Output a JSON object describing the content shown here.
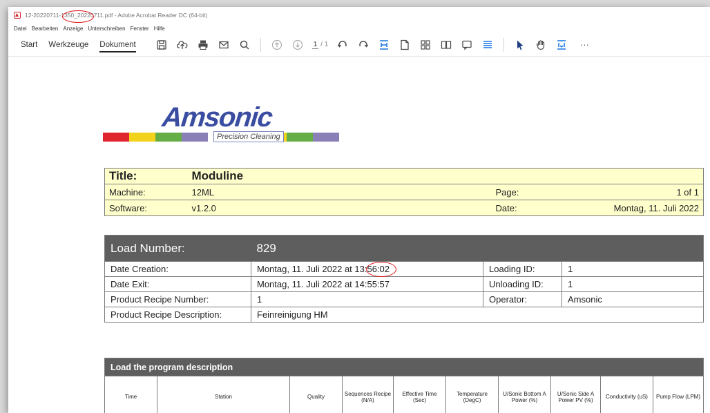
{
  "window": {
    "title": "12-20220711-1350_20220711.pdf - Adobe Acrobat Reader DC (64-bit)"
  },
  "menu": {
    "items": [
      "Datei",
      "Bearbeiten",
      "Anzeige",
      "Unterschreiben",
      "Fenster",
      "Hilfe"
    ]
  },
  "toolbar": {
    "tabs": [
      "Start",
      "Werkzeuge",
      "Dokument"
    ],
    "active_tab": "Dokument",
    "page_current": "1",
    "page_total": "/ 1",
    "more_label": "···",
    "icons": [
      "save-icon",
      "upload-icon",
      "print-icon",
      "email-icon",
      "search-icon",
      "page-up-icon",
      "page-down-icon",
      "rotate-left-icon",
      "rotate-right-icon",
      "fit-page-icon",
      "single-page-icon",
      "thumbnails-icon",
      "two-page-icon",
      "comment-icon",
      "highlight-icon",
      "select-icon",
      "hand-icon",
      "fit-width-icon"
    ]
  },
  "logo": {
    "word": "Amsonic",
    "tagline": "Precision Cleaning",
    "stripe_colors": [
      "#e0252f",
      "#f3d21c",
      "#65ad45",
      "#8b7fb7",
      "#ffffff",
      "#e0252f",
      "#f3d21c",
      "#65ad45",
      "#8b7fb7"
    ]
  },
  "info": {
    "title_label": "Title:",
    "title_value": "Moduline",
    "machine_label": "Machine:",
    "machine_value": "12ML",
    "page_label": "Page:",
    "page_value": "1 of 1",
    "software_label": "Software:",
    "software_value": "v1.2.0",
    "date_label": "Date:",
    "date_value": "Montag, 11. Juli 2022"
  },
  "load": {
    "number_label": "Load Number:",
    "number_value": "829",
    "creation_label": "Date Creation:",
    "creation_value": "Montag, 11. Juli 2022 at 13:56:02",
    "loading_id_label": "Loading ID:",
    "loading_id_value": "1",
    "exit_label": "Date Exit:",
    "exit_value": "Montag, 11. Juli 2022 at 14:55:57",
    "unloading_id_label": "Unloading ID:",
    "unloading_id_value": "1",
    "recipe_number_label": "Product Recipe Number:",
    "recipe_number_value": "1",
    "operator_label": "Operator:",
    "operator_value": "Amsonic",
    "recipe_desc_label": "Product Recipe Description:",
    "recipe_desc_value": "Feinreinigung HM"
  },
  "program": {
    "heading": "Load the program description",
    "columns": [
      "Time",
      "Station",
      "Quality",
      "Sequences Recipe (N/A)",
      "Effective Time (Sec)",
      "Temperature (DegC)",
      "U/Sonic Bottom A Power (%)",
      "U/Sonic Side A Power PV (%)",
      "Conductivity (uS)",
      "Pump Flow (LPM)"
    ]
  }
}
